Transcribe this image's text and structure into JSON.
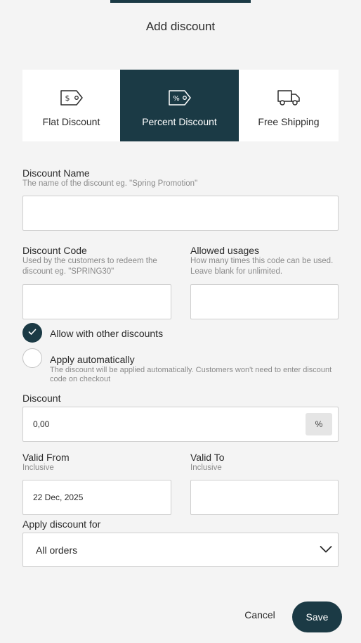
{
  "modal": {
    "title": "Add discount"
  },
  "discount_types": [
    {
      "label": "Flat Discount",
      "icon": "price-tag-dollar-icon",
      "selected": false
    },
    {
      "label": "Percent Discount",
      "icon": "price-tag-percent-icon",
      "selected": true
    },
    {
      "label": "Free Shipping",
      "icon": "truck-icon",
      "selected": false
    }
  ],
  "name_field": {
    "label": "Discount Name",
    "help": "The name of the discount eg. \"Spring Promotion\"",
    "value": ""
  },
  "code_field": {
    "label": "Discount Code",
    "help": "Used by the customers to redeem the discount eg. \"SPRING30\"",
    "value": ""
  },
  "usages_field": {
    "label": "Allowed usages",
    "help": "How many times this code can be used. Leave blank for unlimited.",
    "value": ""
  },
  "allow_other": {
    "label": "Allow with other discounts",
    "checked": true
  },
  "apply_auto": {
    "label": "Apply automatically",
    "help": "The discount will be applied automatically. Customers won't need to enter discount code on checkout",
    "checked": false
  },
  "discount_field": {
    "label": "Discount",
    "value": "0,00",
    "unit": "%"
  },
  "valid_from": {
    "label": "Valid From",
    "help": "Inclusive",
    "value": "22 Dec, 2025"
  },
  "valid_to": {
    "label": "Valid To",
    "help": "Inclusive",
    "value": ""
  },
  "apply_for": {
    "label": "Apply discount for",
    "selected": "All orders"
  },
  "actions": {
    "cancel": "Cancel",
    "save": "Save"
  },
  "colors": {
    "accent": "#1b3a45",
    "background": "#f4f4f4",
    "border": "#cfcfcf"
  }
}
